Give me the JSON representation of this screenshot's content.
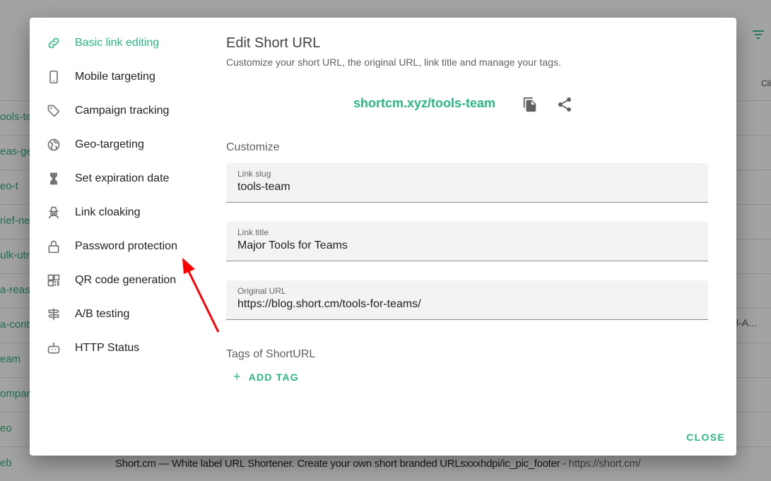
{
  "background": {
    "column_header": "Cli",
    "rows": [
      "ools-tea",
      "eas-ge",
      "eo-t",
      "rief-new",
      "ulk-utm",
      "a-reaso",
      "a-conte",
      "eam",
      "ompari",
      "eo",
      "eb"
    ],
    "row_extra": {
      "index": 6,
      "text": "l-A..."
    },
    "footer_title": "Short.cm — White label URL Shortener. Create your own short branded URLsxxxhdpi/ic_pic_footer",
    "footer_sep": " - ",
    "footer_link": "https://short.cm/"
  },
  "dialog": {
    "menu": [
      {
        "label": "Basic link editing",
        "icon": "link-icon",
        "active": true
      },
      {
        "label": "Mobile targeting",
        "icon": "mobile-icon"
      },
      {
        "label": "Campaign tracking",
        "icon": "tag-icon"
      },
      {
        "label": "Geo-targeting",
        "icon": "globe-icon"
      },
      {
        "label": "Set expiration date",
        "icon": "hourglass-icon"
      },
      {
        "label": "Link cloaking",
        "icon": "spy-icon"
      },
      {
        "label": "Password protection",
        "icon": "lock-icon"
      },
      {
        "label": "QR code generation",
        "icon": "qr-code-icon"
      },
      {
        "label": "A/B testing",
        "icon": "signpost-icon"
      },
      {
        "label": "HTTP Status",
        "icon": "robot-icon"
      }
    ],
    "title": "Edit Short URL",
    "subtitle": "Customize your short URL, the original URL, link title and manage your tags.",
    "short_url": "shortcm.xyz/tools-team",
    "customize_label": "Customize",
    "fields": [
      {
        "label": "Link slug",
        "value": "tools-team"
      },
      {
        "label": "Link title",
        "value": "Major Tools for Teams"
      },
      {
        "label": "Original URL",
        "value": "https://blog.short.cm/tools-for-teams/"
      }
    ],
    "tags_label": "Tags of ShortURL",
    "add_tag": "ADD TAG",
    "close": "CLOSE"
  },
  "colors": {
    "accent": "#2bb784",
    "annotation_arrow": "#ff0000"
  }
}
